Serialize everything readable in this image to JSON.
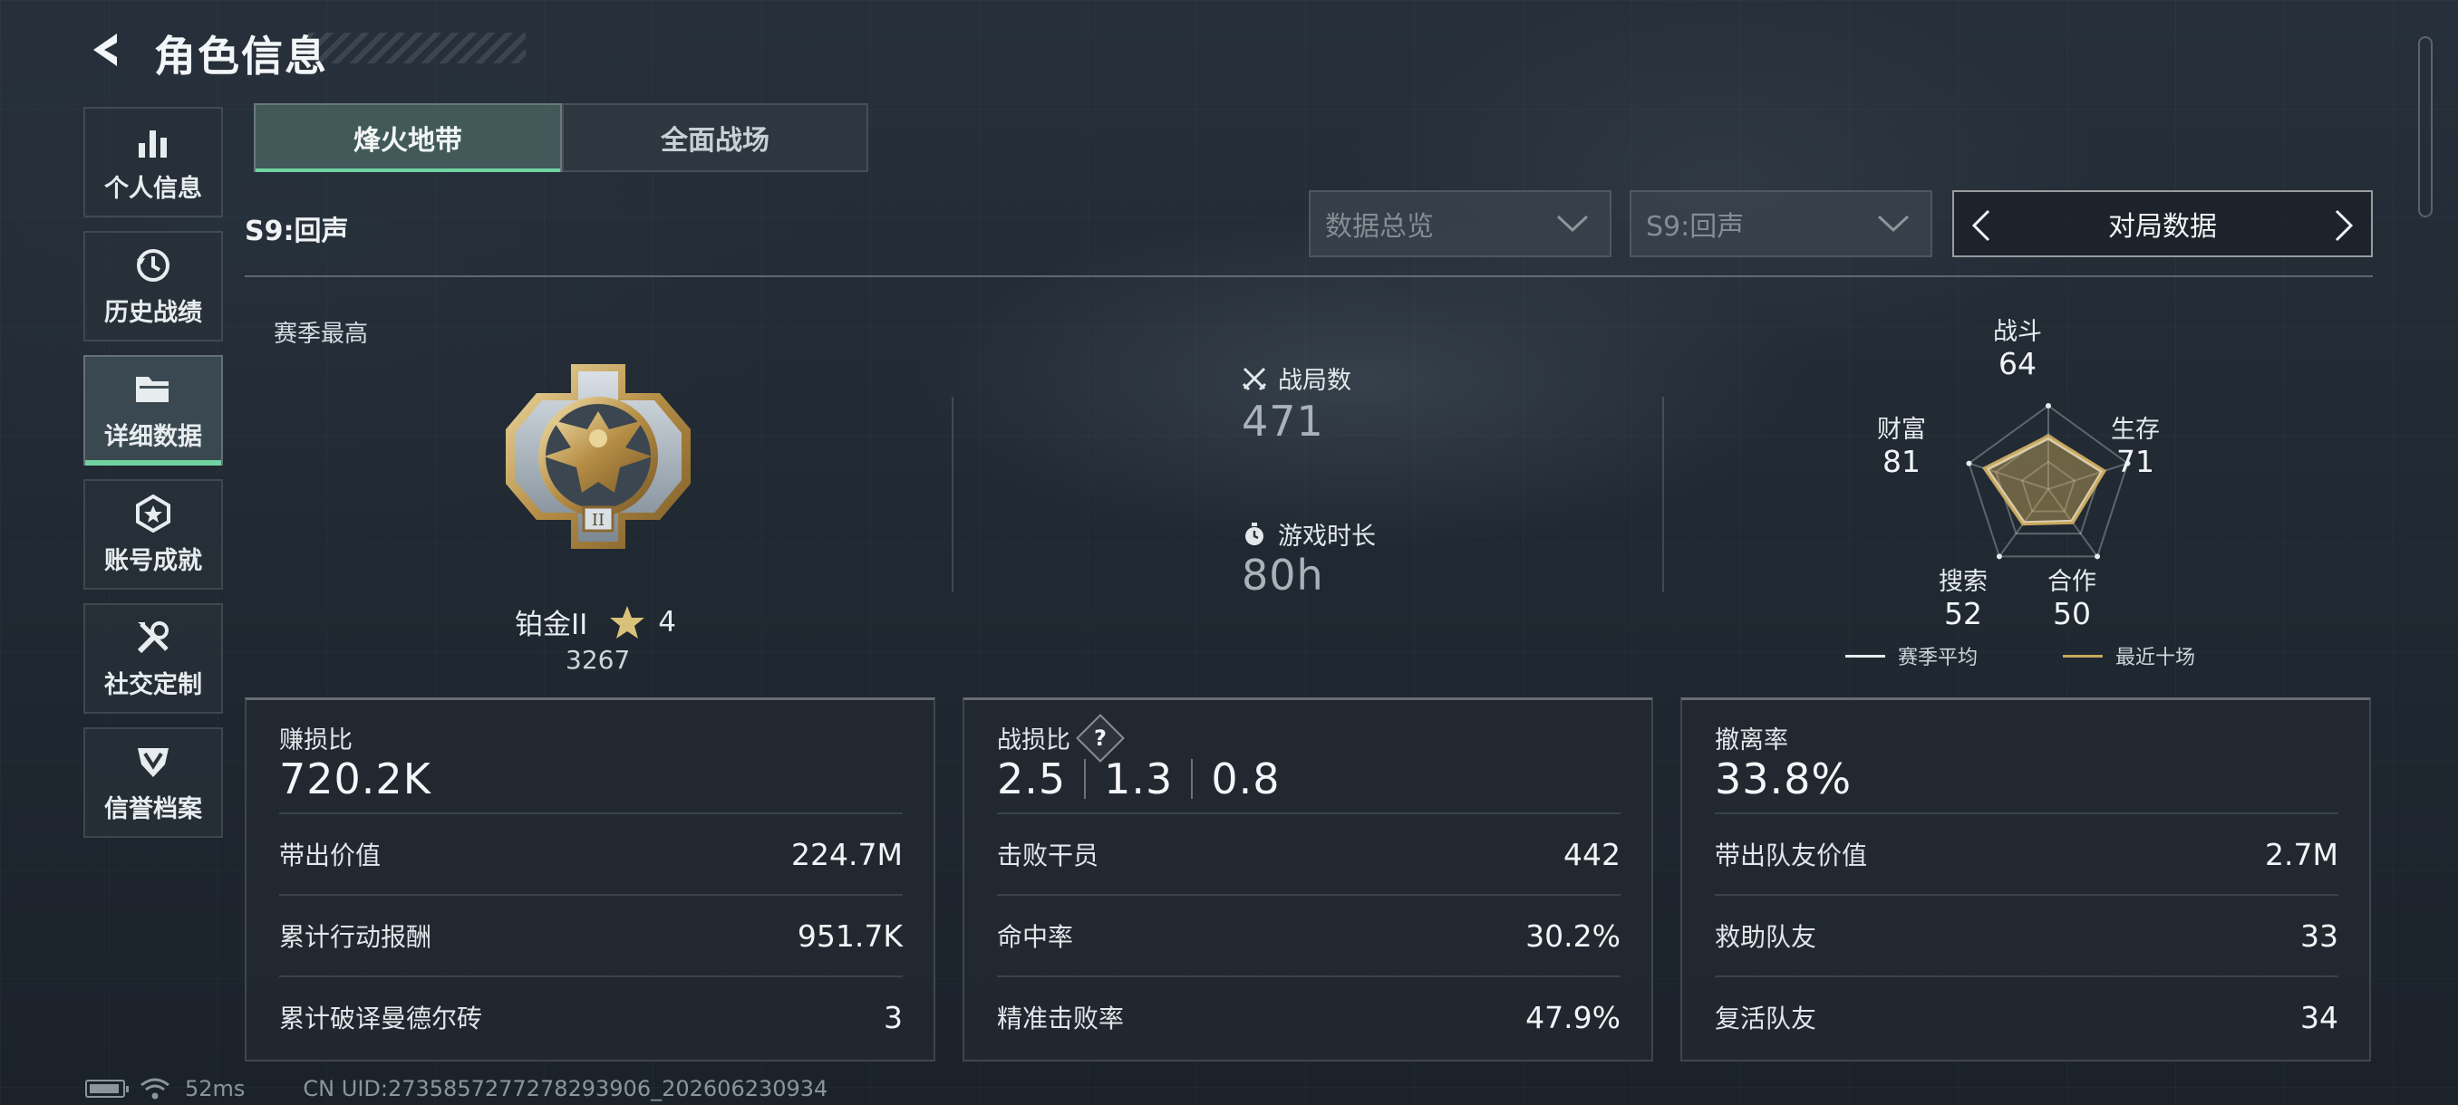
{
  "header": {
    "title": "角色信息"
  },
  "sidebar": {
    "items": [
      {
        "label": "个人信息",
        "icon": "bar-chart-icon"
      },
      {
        "label": "历史战绩",
        "icon": "history-icon"
      },
      {
        "label": "详细数据",
        "icon": "folder-icon",
        "active": true
      },
      {
        "label": "账号成就",
        "icon": "achievement-icon"
      },
      {
        "label": "社交定制",
        "icon": "tools-icon"
      },
      {
        "label": "信誉档案",
        "icon": "shield-icon"
      }
    ]
  },
  "tabs": [
    {
      "label": "烽火地带",
      "active": true
    },
    {
      "label": "全面战场",
      "active": false
    }
  ],
  "season": {
    "label": "S9:回声"
  },
  "filters": {
    "data_type": "数据总览",
    "season_select": "S9:回声",
    "pager_label": "对局数据"
  },
  "season_best": {
    "label": "赛季最高",
    "rank_name": "铂金II",
    "stars": "4",
    "score": "3267"
  },
  "stats": {
    "matches_label": "战局数",
    "matches_value": "471",
    "playtime_label": "游戏时长",
    "playtime_value": "80h"
  },
  "radar": {
    "axes": [
      {
        "label": "战斗",
        "value": 64
      },
      {
        "label": "生存",
        "value": 71
      },
      {
        "label": "合作",
        "value": 50
      },
      {
        "label": "搜索",
        "value": 52
      },
      {
        "label": "财富",
        "value": 81
      }
    ],
    "legend_season_avg": "赛季平均",
    "legend_recent": "最近十场",
    "color_season_avg": "#e8ecef",
    "color_recent": "#c9a85c"
  },
  "cards": {
    "profit": {
      "title": "赚损比",
      "value": "720.2K",
      "rows": [
        {
          "label": "带出价值",
          "value": "224.7M"
        },
        {
          "label": "累计行动报酬",
          "value": "951.7K"
        },
        {
          "label": "累计破译曼德尔砖",
          "value": "3"
        }
      ]
    },
    "combat": {
      "title": "战损比",
      "help": "?",
      "ratios": [
        "2.5",
        "1.3",
        "0.8"
      ],
      "rows": [
        {
          "label": "击败干员",
          "value": "442"
        },
        {
          "label": "命中率",
          "value": "30.2%"
        },
        {
          "label": "精准击败率",
          "value": "47.9%"
        }
      ]
    },
    "extract": {
      "title": "撤离率",
      "value": "33.8%",
      "rows": [
        {
          "label": "带出队友价值",
          "value": "2.7M"
        },
        {
          "label": "救助队友",
          "value": "33"
        },
        {
          "label": "复活队友",
          "value": "34"
        }
      ]
    }
  },
  "footer": {
    "ping": "52ms",
    "uid": "CN UID:2735857277278293906_202606230934"
  },
  "colors": {
    "accent_green": "#6fd4a0",
    "star_gold": "#d8c27a"
  }
}
